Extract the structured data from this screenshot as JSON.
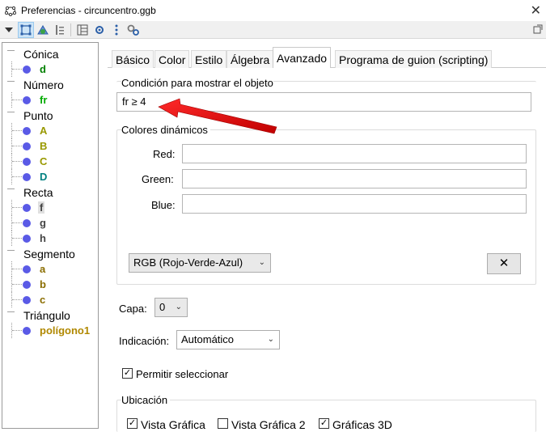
{
  "window": {
    "title": "Preferencias - circuncentro.ggb",
    "close_glyph": "✕"
  },
  "tree": {
    "categories": [
      {
        "label": "Cónica",
        "items": [
          {
            "name": "d",
            "color": "#008000"
          }
        ]
      },
      {
        "label": "Número",
        "items": [
          {
            "name": "fr",
            "color": "#00aa00"
          }
        ]
      },
      {
        "label": "Punto",
        "items": [
          {
            "name": "A",
            "color": "#999900"
          },
          {
            "name": "B",
            "color": "#999900"
          },
          {
            "name": "C",
            "color": "#999900"
          },
          {
            "name": "D",
            "color": "#008080"
          }
        ]
      },
      {
        "label": "Recta",
        "items": [
          {
            "name": "f",
            "color": "#444444"
          },
          {
            "name": "g",
            "color": "#444444"
          },
          {
            "name": "h",
            "color": "#444444"
          }
        ]
      },
      {
        "label": "Segmento",
        "items": [
          {
            "name": "a",
            "color": "#8a6d00"
          },
          {
            "name": "b",
            "color": "#8a6d00"
          },
          {
            "name": "c",
            "color": "#8a6d00"
          }
        ]
      },
      {
        "label": "Triángulo",
        "items": [
          {
            "name": "polígono1",
            "color": "#b08800"
          }
        ]
      }
    ]
  },
  "tabs": [
    "Básico",
    "Color",
    "Estilo",
    "Álgebra",
    "Avanzado",
    "Programa de guion (scripting)"
  ],
  "active_tab": "Avanzado",
  "condition": {
    "title": "Condición para mostrar el objeto",
    "value": "fr ≥ 4"
  },
  "dynamic_colors": {
    "title": "Colores dinámicos",
    "red_label": "Red:",
    "green_label": "Green:",
    "blue_label": "Blue:",
    "mode": "RGB (Rojo-Verde-Azul)",
    "clear_glyph": "✕"
  },
  "layer": {
    "label": "Capa:",
    "value": "0"
  },
  "indication": {
    "label": "Indicación:",
    "value": "Automático"
  },
  "allow_select": {
    "label": "Permitir seleccionar",
    "checked": true
  },
  "location": {
    "title": "Ubicación",
    "options": [
      {
        "label": "Vista Gráfica",
        "checked": true
      },
      {
        "label": "Vista Gráfica 2",
        "checked": false
      },
      {
        "label": "Gráficas 3D",
        "checked": true
      }
    ]
  },
  "colors": {
    "annotation_arrow": "#e00000",
    "point_dot": "#5a5ae6"
  }
}
